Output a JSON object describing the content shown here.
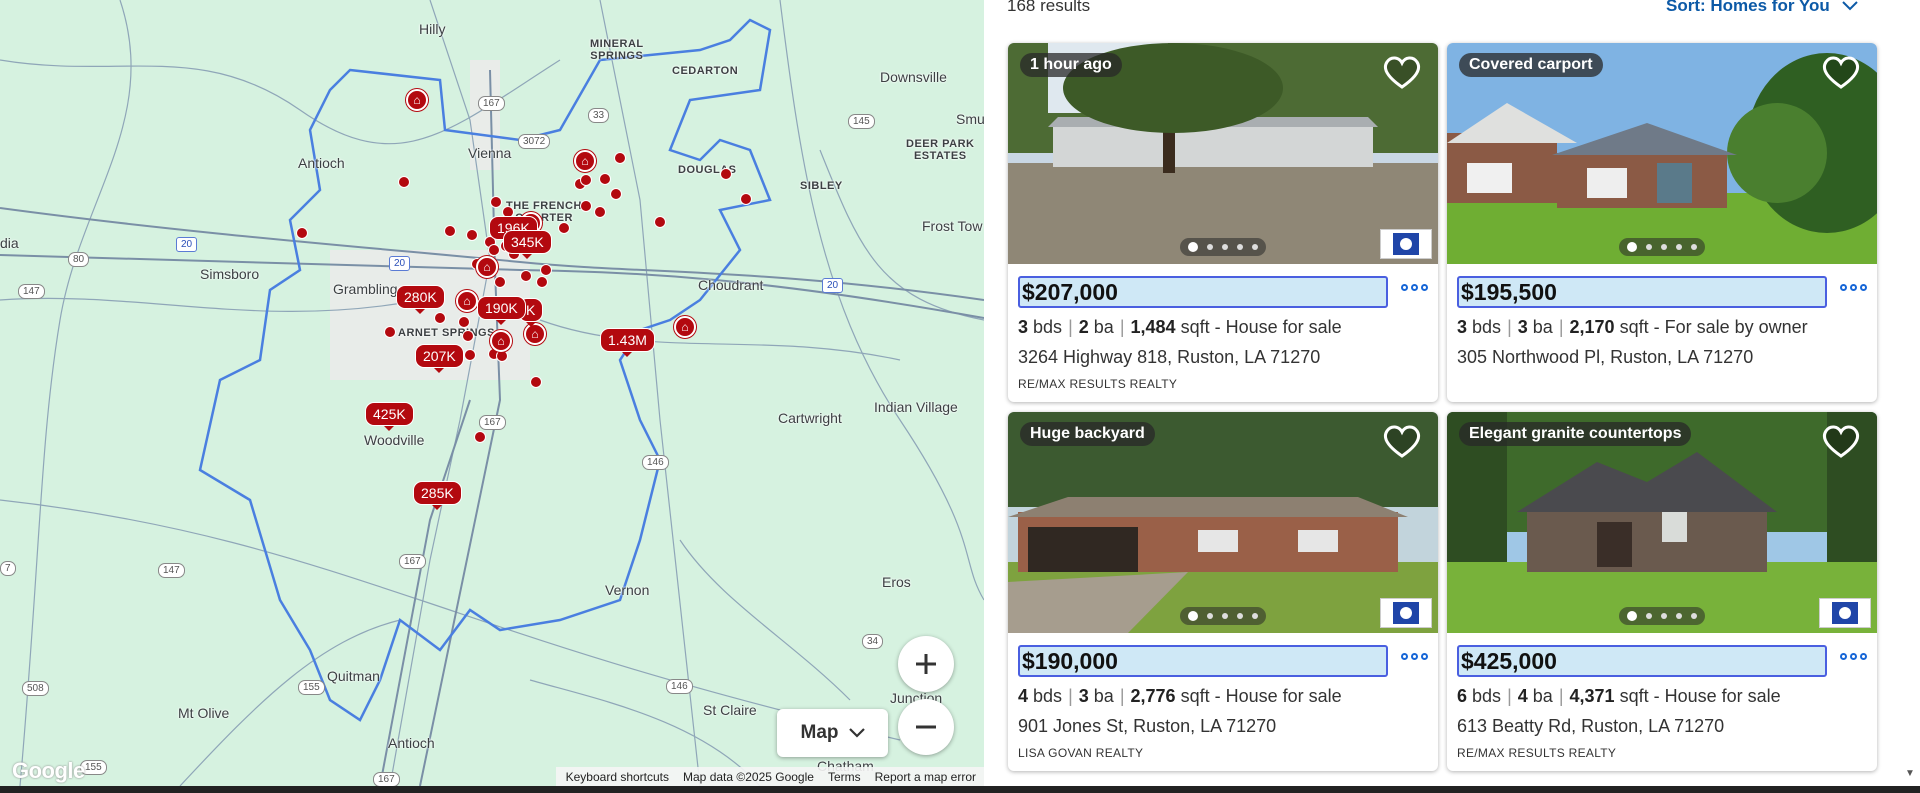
{
  "results": {
    "count_text": "168 results",
    "sort_label": "Sort: Homes for You"
  },
  "map": {
    "places": [
      {
        "name": "Hilly"
      },
      {
        "name": "MINERAL\nSPRINGS"
      },
      {
        "name": "CEDARTON"
      },
      {
        "name": "Downsville"
      },
      {
        "name": "Smu"
      },
      {
        "name": "Antioch"
      },
      {
        "name": "Vienna"
      },
      {
        "name": "DOUGLAS"
      },
      {
        "name": "DEER PARK\nESTATES"
      },
      {
        "name": "SIBLEY"
      },
      {
        "name": "THE FRENCH\nQUARTER"
      },
      {
        "name": "Frost Tow"
      },
      {
        "name": "dia"
      },
      {
        "name": "Simsboro"
      },
      {
        "name": "Grambling"
      },
      {
        "name": "Choudrant"
      },
      {
        "name": "ARNET SPRINGS"
      },
      {
        "name": "Indian Village"
      },
      {
        "name": "Cartwright"
      },
      {
        "name": "Woodville"
      },
      {
        "name": "Eros"
      },
      {
        "name": "Vernon"
      },
      {
        "name": "Quitman"
      },
      {
        "name": "Junction"
      },
      {
        "name": "Mt Olive"
      },
      {
        "name": "St Claire"
      },
      {
        "name": "Antioch"
      },
      {
        "name": "Chatham"
      }
    ],
    "shields": [
      "167",
      "3072",
      "33",
      "145",
      "20",
      "80",
      "20",
      "20",
      "147",
      "167",
      "146",
      "167",
      "147",
      "7",
      "508",
      "155",
      "146",
      "34",
      "155",
      "167"
    ],
    "price_pins": [
      "196K",
      "345K",
      "280K",
      "190K",
      "K",
      "207K",
      "1.43M",
      "425K",
      "285K"
    ],
    "controls": {
      "zoom_in": "Zoom in",
      "zoom_out": "Zoom out",
      "map_type": "Map"
    },
    "logo": "Google",
    "attribution": [
      "Keyboard shortcuts",
      "Map data ©2025 Google",
      "Terms",
      "Report a map error"
    ],
    "colors": {
      "boundary": "#4a7fe0",
      "pin": "#b3090f",
      "land": "#d6f2e0"
    }
  },
  "listings": [
    {
      "tag": "1 hour ago",
      "price": "$207,000",
      "beds": "3",
      "beds_label": "bds",
      "baths": "2",
      "baths_label": "ba",
      "sqft": "1,484",
      "sqft_label": "sqft",
      "status": "- House for sale",
      "address": "3264 Highway 818, Ruston, LA 71270",
      "broker": "RE/MAX RESULTS REALTY",
      "photo_icon": "house-photo-1"
    },
    {
      "tag": "Covered carport",
      "price": "$195,500",
      "beds": "3",
      "beds_label": "bds",
      "baths": "3",
      "baths_label": "ba",
      "sqft": "2,170",
      "sqft_label": "sqft",
      "status": "- For sale by owner",
      "address": "305 Northwood Pl, Ruston, LA 71270",
      "broker": "",
      "photo_icon": "house-photo-2"
    },
    {
      "tag": "Huge backyard",
      "price": "$190,000",
      "beds": "4",
      "beds_label": "bds",
      "baths": "3",
      "baths_label": "ba",
      "sqft": "2,776",
      "sqft_label": "sqft",
      "status": "- House for sale",
      "address": "901 Jones St, Ruston, LA 71270",
      "broker": "LISA GOVAN REALTY",
      "photo_icon": "house-photo-3"
    },
    {
      "tag": "Elegant granite countertops",
      "price": "$425,000",
      "beds": "6",
      "beds_label": "bds",
      "baths": "4",
      "baths_label": "ba",
      "sqft": "4,371",
      "sqft_label": "sqft",
      "status": "- House for sale",
      "address": "613 Beatty Rd, Ruston, LA 71270",
      "broker": "RE/MAX RESULTS REALTY",
      "photo_icon": "house-photo-4"
    }
  ]
}
